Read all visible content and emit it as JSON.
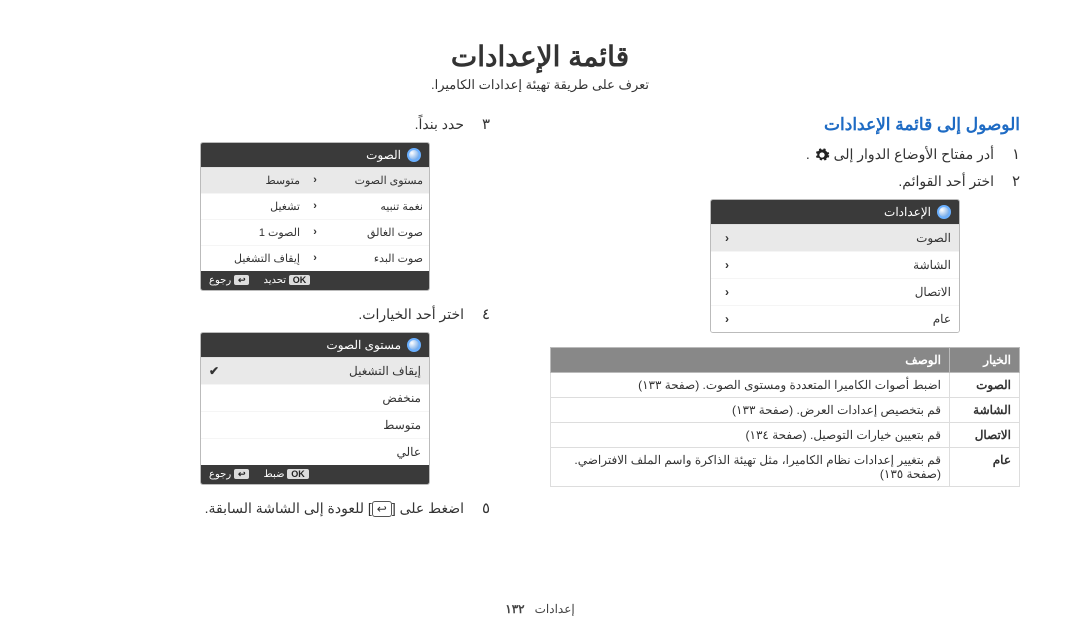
{
  "title": "قائمة الإعدادات",
  "intro": "تعرف على طريقة تهيئة إعدادات الكاميرا.",
  "right": {
    "section": "الوصول إلى قائمة الإعدادات",
    "step1_num": "١",
    "step1": "أدر مفتاح الأوضاع الدوار إلى",
    "step1_tail": ".",
    "step2_num": "٢",
    "step2": "اختر أحد القوائم.",
    "menu_header": "الإعدادات",
    "menu_items": [
      "الصوت",
      "الشاشة",
      "الاتصال",
      "عام"
    ],
    "table_header_option": "الخيار",
    "table_header_desc": "الوصف",
    "table_rows": [
      {
        "opt": "الصوت",
        "desc": "اضبط أصوات الكاميرا المتعددة ومستوى الصوت. (صفحة ١٣٣)"
      },
      {
        "opt": "الشاشة",
        "desc": "قم بتخصيص إعدادات العرض. (صفحة ١٣٣)"
      },
      {
        "opt": "الاتصال",
        "desc": "قم بتعيين خيارات التوصيل. (صفحة ١٣٤)"
      },
      {
        "opt": "عام",
        "desc": "قم بتغيير إعدادات نظام الكاميرا، مثل تهيئة الذاكرة واسم الملف الافتراضي. (صفحة ١٣٥)"
      }
    ]
  },
  "left": {
    "step3_num": "٣",
    "step3": "حدد بنداً.",
    "menu1_header": "الصوت",
    "menu1_rows": [
      {
        "r": "مستوى الصوت",
        "l": "متوسط",
        "sel": true
      },
      {
        "r": "نغمة تنبيه",
        "l": "تشغيل"
      },
      {
        "r": "صوت الغالق",
        "l": "الصوت 1"
      },
      {
        "r": "صوت البدء",
        "l": "إيقاف التشغيل"
      }
    ],
    "footer1_a": "تحديد",
    "footer1_b": "رجوع",
    "step4_num": "٤",
    "step4": "اختر أحد الخيارات.",
    "menu2_header": "مستوى الصوت",
    "menu2_rows": [
      {
        "label": "إيقاف التشغيل",
        "sel": true
      },
      {
        "label": "منخفض"
      },
      {
        "label": "متوسط"
      },
      {
        "label": "عالي"
      }
    ],
    "footer2_a": "ضبط",
    "footer2_b": "رجوع",
    "step5_num": "٥",
    "step5_pre": "اضغط على [",
    "step5_post": "] للعودة إلى الشاشة السابقة."
  },
  "footer_label": "إعدادات",
  "footer_page": "١٣٢"
}
